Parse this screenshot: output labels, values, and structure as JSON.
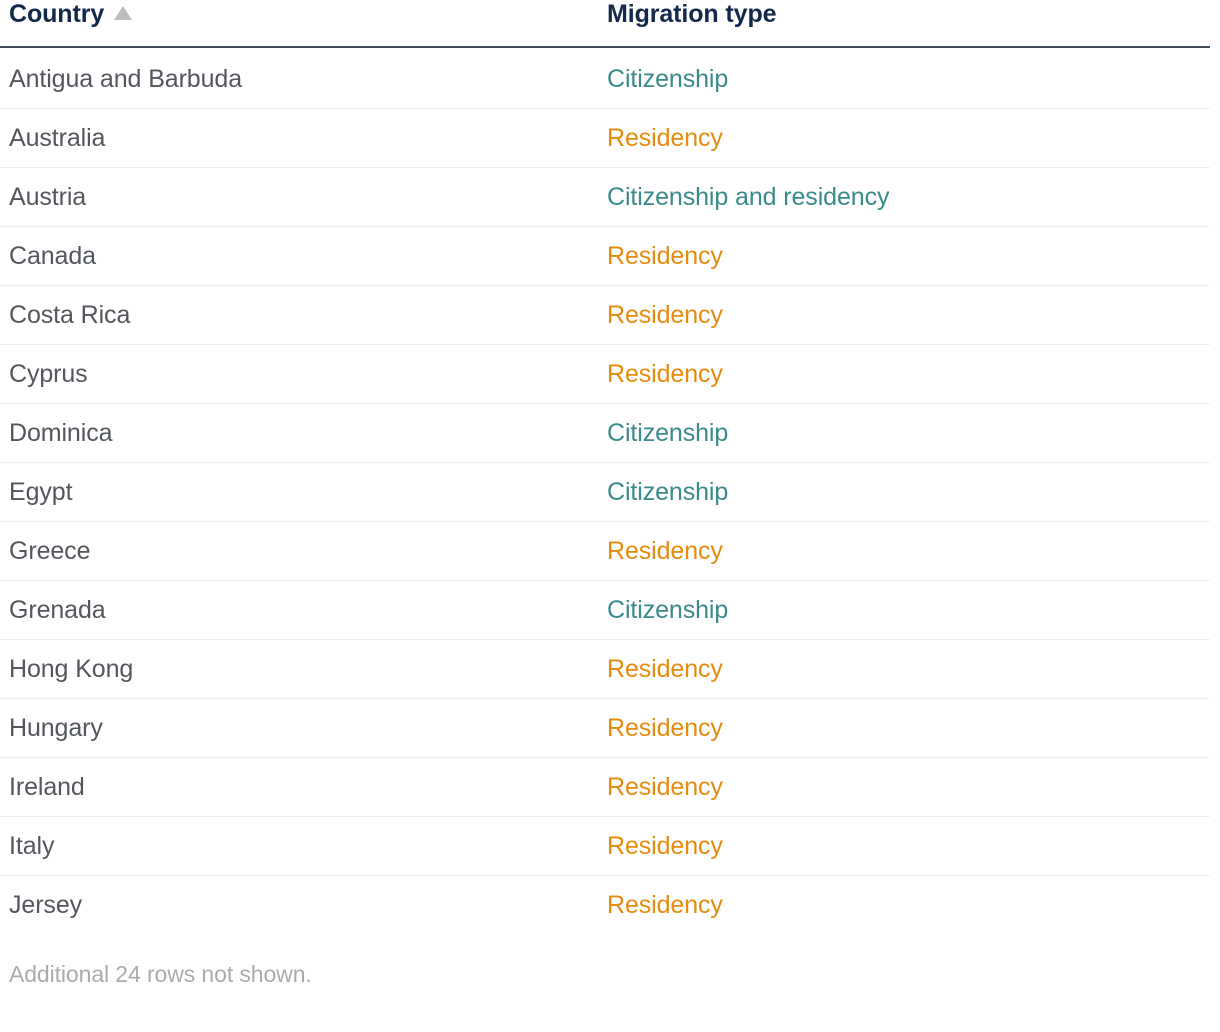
{
  "table": {
    "columns": [
      {
        "key": "country",
        "label": "Country",
        "sort": "ascending",
        "sort_icon": "triangle-up-icon"
      },
      {
        "key": "migration_type",
        "label": "Migration type",
        "sort": "none"
      }
    ],
    "rows": [
      {
        "country": "Antigua and Barbuda",
        "migration_type": "Citizenship"
      },
      {
        "country": "Australia",
        "migration_type": "Residency"
      },
      {
        "country": "Austria",
        "migration_type": "Citizenship and residency"
      },
      {
        "country": "Canada",
        "migration_type": "Residency"
      },
      {
        "country": "Costa Rica",
        "migration_type": "Residency"
      },
      {
        "country": "Cyprus",
        "migration_type": "Residency"
      },
      {
        "country": "Dominica",
        "migration_type": "Citizenship"
      },
      {
        "country": "Egypt",
        "migration_type": "Citizenship"
      },
      {
        "country": "Greece",
        "migration_type": "Residency"
      },
      {
        "country": "Grenada",
        "migration_type": "Citizenship"
      },
      {
        "country": "Hong Kong",
        "migration_type": "Residency"
      },
      {
        "country": "Hungary",
        "migration_type": "Residency"
      },
      {
        "country": "Ireland",
        "migration_type": "Residency"
      },
      {
        "country": "Italy",
        "migration_type": "Residency"
      },
      {
        "country": "Jersey",
        "migration_type": "Residency"
      }
    ],
    "footnote": "Additional 24 rows not shown.",
    "hidden_row_count": 24
  },
  "colors": {
    "header_text": "#13294b",
    "header_rule": "#444e5a",
    "country_text": "#53575d",
    "row_divider": "#eeeeef",
    "citizenship": "#3a8a8b",
    "residency": "#e78b0d",
    "sort_icon": "#bdbdbd",
    "footnote_text": "#a9abae",
    "background": "#ffffff"
  }
}
